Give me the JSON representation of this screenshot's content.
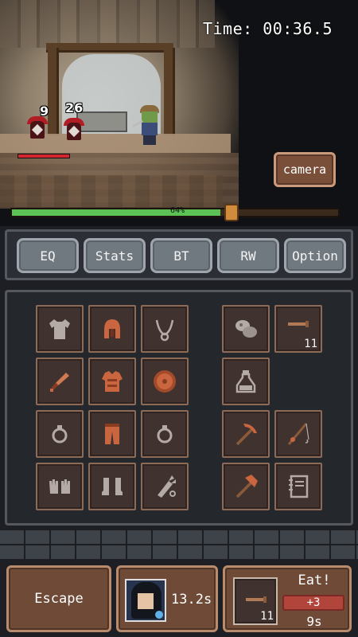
{
  "hud": {
    "timer": "Time: 00:36.5",
    "camera_label": "camera",
    "progress_label": "64%",
    "progress_value": 64
  },
  "battle": {
    "enemies": [
      {
        "damage": "9"
      },
      {
        "damage": "26"
      }
    ],
    "enemy_hp_fraction": 1.0
  },
  "tabs": [
    {
      "label": "EQ",
      "active": true
    },
    {
      "label": "Stats",
      "active": false
    },
    {
      "label": "BT",
      "active": false
    },
    {
      "label": "RW",
      "active": false
    },
    {
      "label": "Option",
      "active": false
    }
  ],
  "inventory": {
    "equipment": [
      {
        "name": "shirt-icon"
      },
      {
        "name": "helmet-icon"
      },
      {
        "name": "necklace-icon"
      },
      {
        "name": "dagger-icon"
      },
      {
        "name": "chest-armor-icon"
      },
      {
        "name": "round-shield-icon"
      },
      {
        "name": "ring-icon"
      },
      {
        "name": "leg-armor-icon"
      },
      {
        "name": "ring-icon"
      },
      {
        "name": "gloves-icon"
      },
      {
        "name": "boots-icon"
      },
      {
        "name": "quiver-icon"
      }
    ],
    "tools": [
      {
        "name": "stone-ore-icon",
        "count": ""
      },
      {
        "name": "fish-icon",
        "count": "11"
      },
      {
        "name": "potion-bottle-icon",
        "count": ""
      },
      {
        "name": "pickaxe-icon",
        "count": ""
      },
      {
        "name": "fishing-rod-icon",
        "count": ""
      },
      {
        "name": "axe-icon",
        "count": ""
      },
      {
        "name": "notebook-icon",
        "count": ""
      }
    ]
  },
  "bottom": {
    "escape_label": "Escape",
    "hero_time": "13.2s",
    "eat": {
      "label": "Eat!",
      "bonus": "+3",
      "seconds": "9s",
      "food_count": "11",
      "food_icon": "fish-icon"
    }
  },
  "colors": {
    "active_tab": "#5b5a16",
    "progress_fill": "#5cc255",
    "hp_red": "#d4262e",
    "slot_border": "#8c6a55",
    "eat_bonus": "#b1453c"
  }
}
